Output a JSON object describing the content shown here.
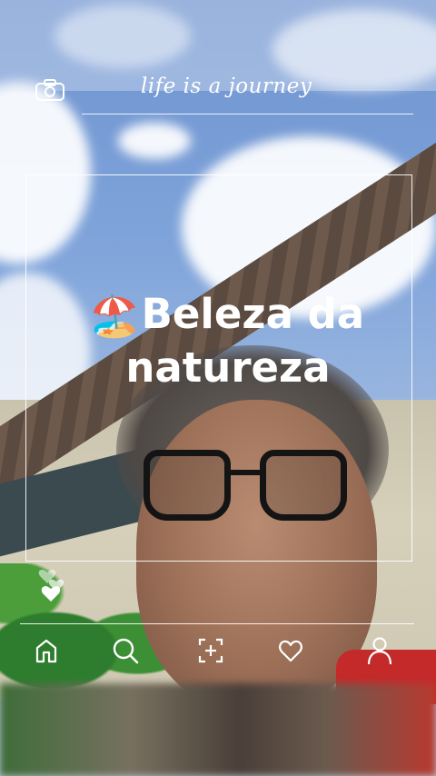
{
  "overlay": {
    "tagline": "life is a journey",
    "headline_emoji": "🏖️",
    "headline_line1": "Beleza da",
    "headline_line2": "natureza"
  },
  "icons": {
    "camera": "camera-icon",
    "hearts": "hearts-icon",
    "nav": [
      "home-icon",
      "search-icon",
      "add-post-icon",
      "heart-icon",
      "profile-icon"
    ]
  },
  "colors": {
    "overlay_text": "#ffffff",
    "shirt": "#c42a2a",
    "sky": "#7ea3da"
  }
}
